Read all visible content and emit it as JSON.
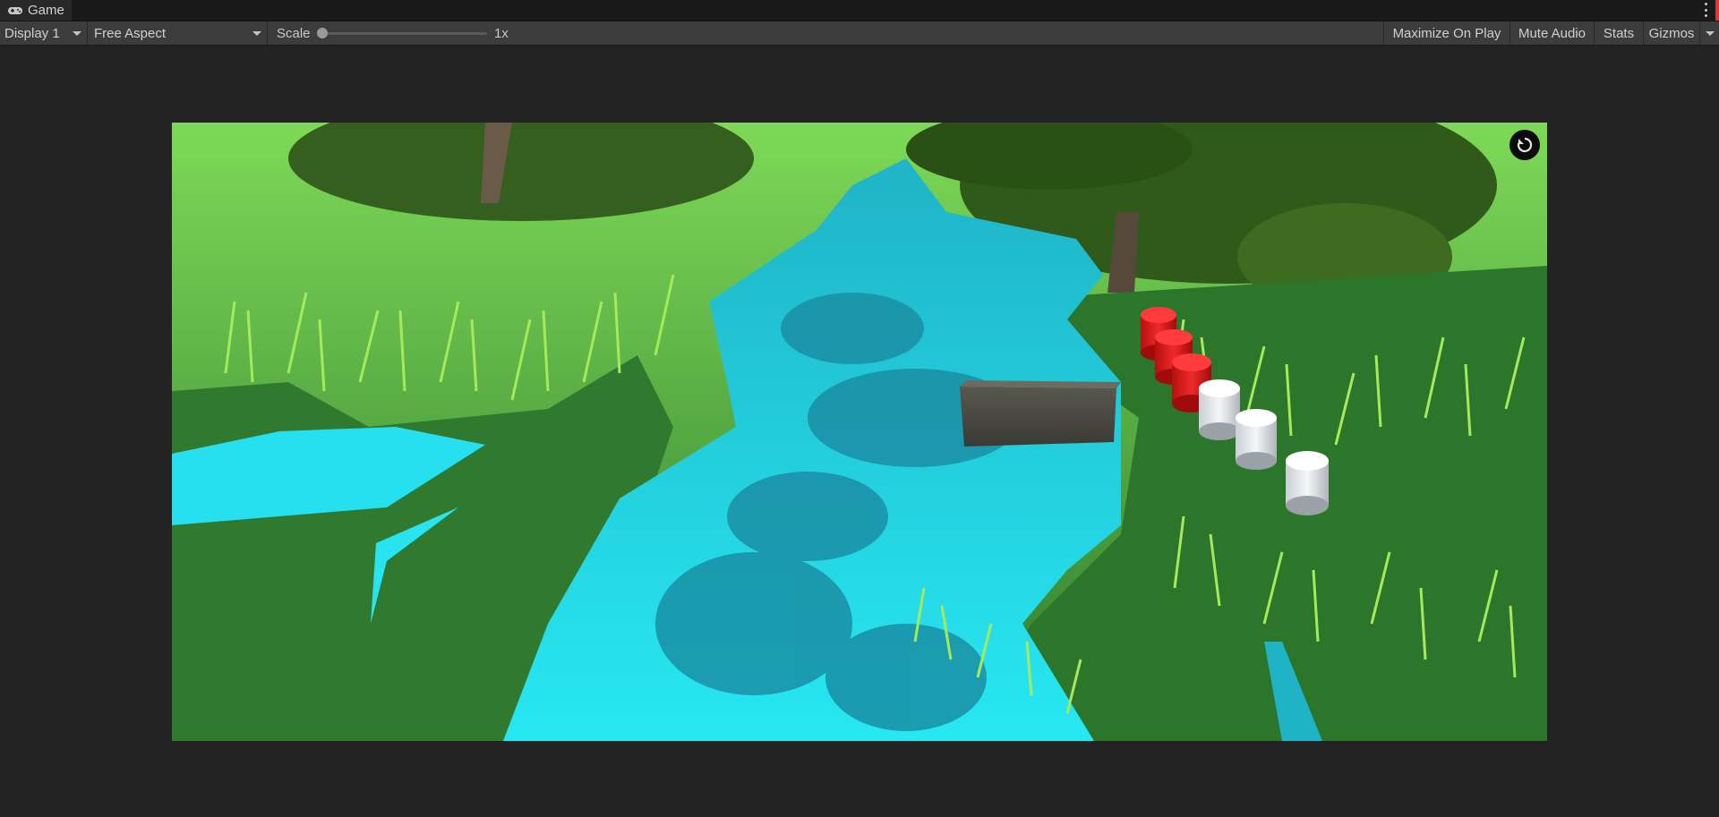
{
  "window": {
    "tab_title": "Game",
    "tab_icon": "gamepad-icon"
  },
  "toolbar": {
    "display": "Display 1",
    "aspect": "Free Aspect",
    "scale_label": "Scale",
    "scale_value": "1x",
    "scale_fraction": 0.0,
    "maximize_on_play": "Maximize On Play",
    "mute_audio": "Mute Audio",
    "stats": "Stats",
    "gizmos": "Gizmos"
  },
  "scene": {
    "red_cylinders": 3,
    "white_cylinders": 3,
    "colors": {
      "water": "#26e6f0",
      "water_shadow": "#1a93a8",
      "ground": "#2f7a2f",
      "grass": "#9be35a",
      "red": "#e01e1e",
      "white": "#e8ecef",
      "stone": "#4d4d47"
    }
  },
  "overlay": {
    "refresh_icon": "refresh-icon"
  }
}
